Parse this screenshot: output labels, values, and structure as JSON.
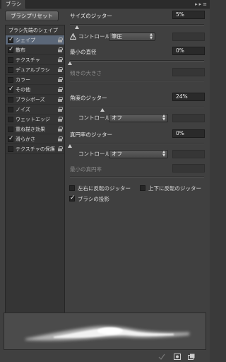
{
  "titlebar": {
    "tab": "ブラシ",
    "icons": [
      "double-arrow-icon",
      "panel-menu-icon"
    ]
  },
  "preset_button": "ブラシプリセット",
  "list": {
    "header": "ブラシ先端のシェイプ",
    "items": [
      {
        "label": "シェイプ",
        "checked": true,
        "selected": true,
        "lock": true
      },
      {
        "label": "散布",
        "checked": true,
        "selected": false,
        "lock": true
      },
      {
        "label": "テクスチャ",
        "checked": false,
        "selected": false,
        "lock": true
      },
      {
        "label": "デュアルブラシ",
        "checked": false,
        "selected": false,
        "lock": true
      },
      {
        "label": "カラー",
        "checked": false,
        "selected": false,
        "lock": true
      },
      {
        "label": "その他",
        "checked": true,
        "selected": false,
        "lock": true
      },
      {
        "label": "ブラシポーズ",
        "checked": false,
        "selected": false,
        "lock": true
      },
      {
        "label": "ノイズ",
        "checked": false,
        "selected": false,
        "lock": true
      },
      {
        "label": "ウェットエッジ",
        "checked": false,
        "selected": false,
        "lock": true
      },
      {
        "label": "重ね描き効果",
        "checked": false,
        "selected": false,
        "lock": true
      },
      {
        "label": "滑らかさ",
        "checked": true,
        "selected": false,
        "lock": true
      },
      {
        "label": "テクスチャの保護",
        "checked": false,
        "selected": false,
        "lock": true
      }
    ]
  },
  "settings": {
    "size_jitter": {
      "label": "サイズのジッター",
      "value": "5%",
      "slider": 0.05
    },
    "size_control": {
      "label": "コントロール：",
      "value": "筆圧"
    },
    "min_diameter": {
      "label": "最小の直径",
      "value": "0%",
      "slider": 0.0
    },
    "tilt_scale": {
      "label": "傾きの大きさ"
    },
    "angle_jitter": {
      "label": "角度のジッター",
      "value": "24%",
      "slider": 0.24
    },
    "angle_control": {
      "label": "コントロール：",
      "value": "オフ"
    },
    "roundness_jitter": {
      "label": "真円率のジッター",
      "value": "0%",
      "slider": 0.0
    },
    "roundness_control": {
      "label": "コントロール：",
      "value": "オフ"
    },
    "min_roundness": {
      "label": "最小の真円率"
    },
    "flip_x": {
      "label": "左右に反転のジッター",
      "checked": false
    },
    "flip_y": {
      "label": "上下に反転のジッター",
      "checked": false
    },
    "brush_projection": {
      "label": "ブラシの投影",
      "checked": true
    }
  },
  "bottom_icons": [
    "toggle-visibility-icon",
    "new-preset-icon",
    "create-new-brush-icon"
  ]
}
